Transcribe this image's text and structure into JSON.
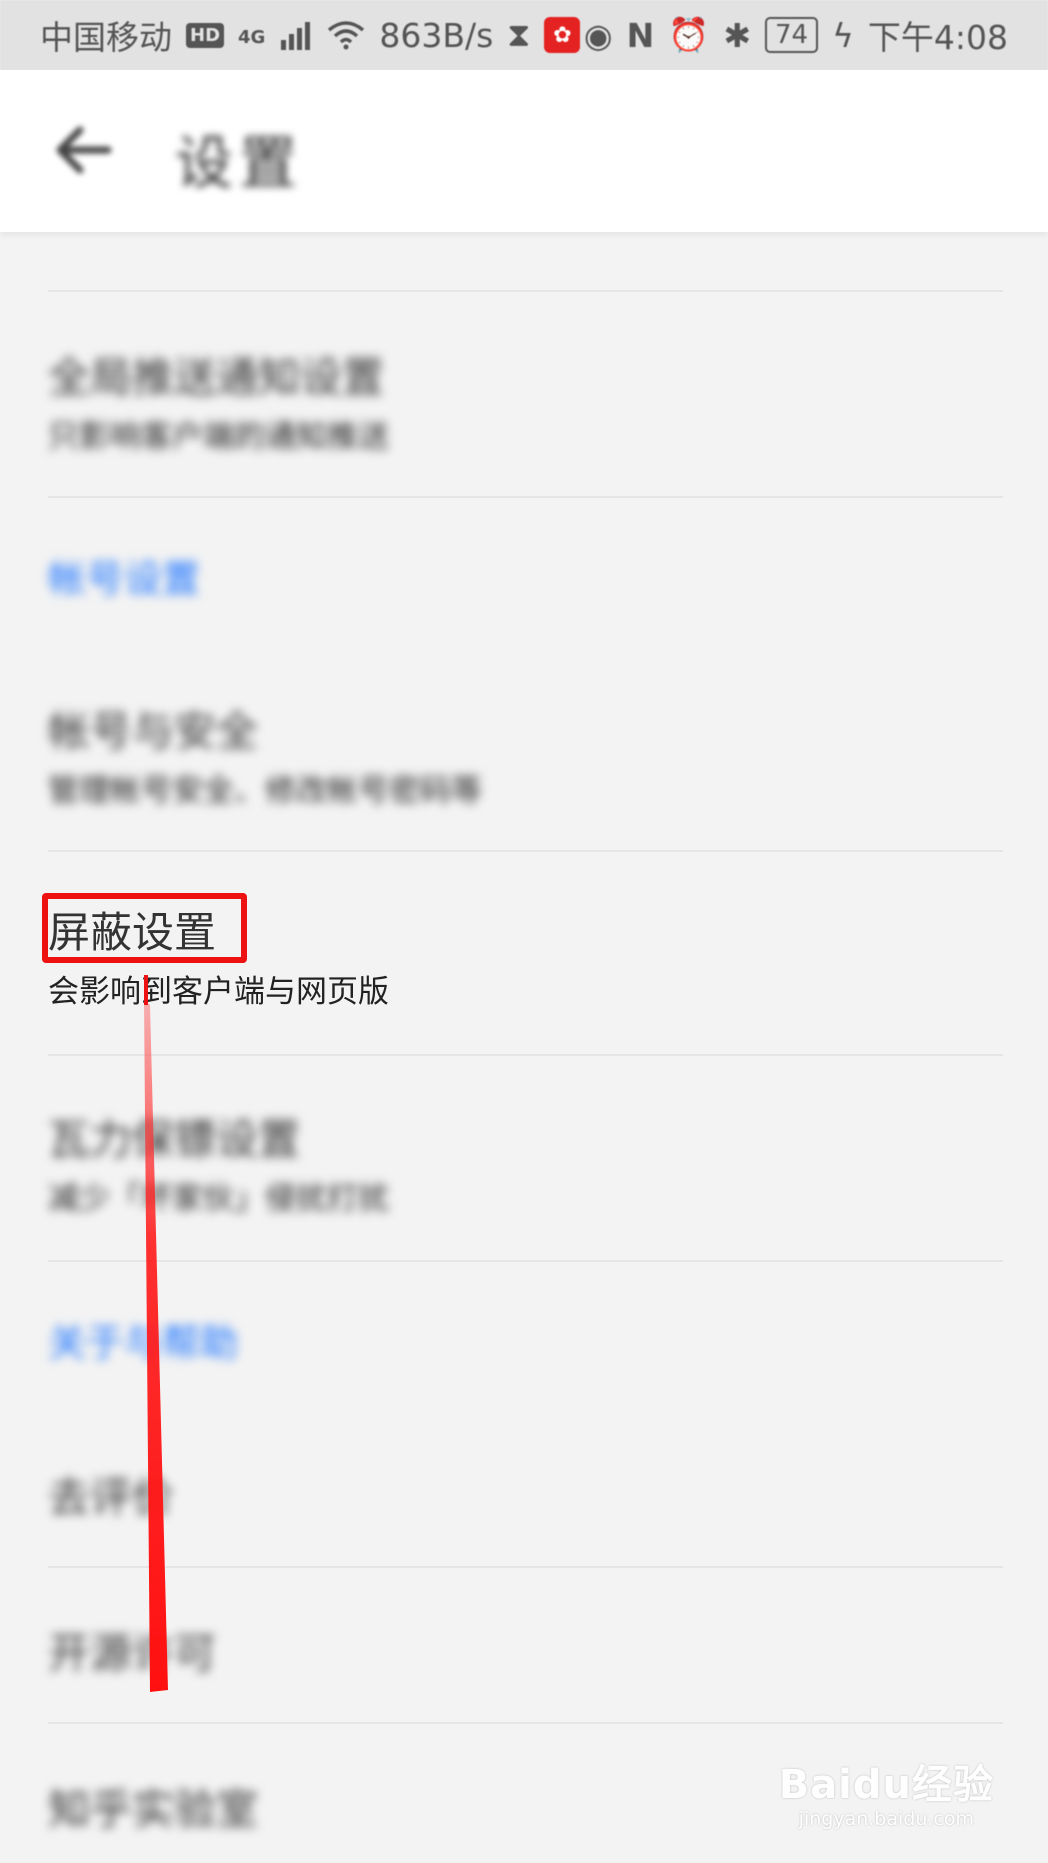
{
  "status_bar": {
    "carrier": "中国移动",
    "hd": "HD",
    "network": "4G",
    "speed": "863B/s",
    "battery": "74",
    "time": "下午4:08"
  },
  "toolbar": {
    "title": "设置"
  },
  "items": {
    "global_push": {
      "title": "全局推送通知设置",
      "subtitle": "只影响客户端的通知推送"
    },
    "account_security": {
      "title": "帐号与安全",
      "subtitle": "管理帐号安全、修改帐号密码等"
    },
    "block_settings": {
      "title": "屏蔽设置",
      "subtitle": "会影响到客户端与网页版"
    },
    "anti_harass": {
      "title": "瓦力保镖设置",
      "subtitle": "减少「坏家伙」侵扰打扰"
    },
    "rate": {
      "title": "去评价"
    },
    "open_source": {
      "title": "开源许可"
    },
    "lab": {
      "title": "知乎实验室"
    }
  },
  "sections": {
    "account": "帐号设置",
    "about": "关于与帮助"
  },
  "watermark": {
    "main": "Baidu经验",
    "sub": "jingyan.baidu.com"
  },
  "colors": {
    "accent": "#1a73ff",
    "highlight": "#ee1111"
  }
}
